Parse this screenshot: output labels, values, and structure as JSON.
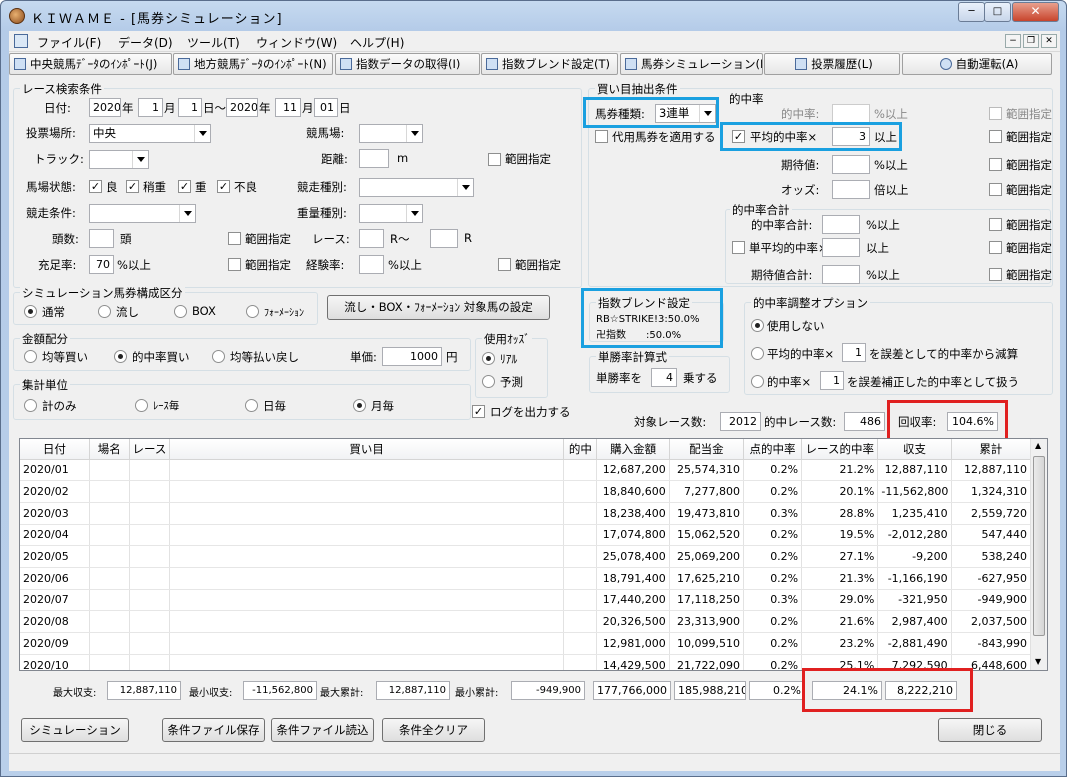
{
  "window": {
    "title": "ＫＩＷＡＭＥ - [馬券シミュレーション]",
    "min": "─",
    "max": "□",
    "close": "✕"
  },
  "menu": [
    "ファイル(F)",
    "データ(D)",
    "ツール(T)",
    "ウィンドウ(W)",
    "ヘルプ(H)"
  ],
  "mdi": {
    "min": "−",
    "restore": "❐",
    "close": "✕"
  },
  "toolbar": [
    "中央競馬ﾃﾞｰﾀのｲﾝﾎﾟｰﾄ(J)",
    "地方競馬ﾃﾞｰﾀのｲﾝﾎﾟｰﾄ(N)",
    "指数データの取得(I)",
    "指数ブレンド設定(T)",
    "馬券シミュレーション(B)",
    "投票履歴(L)",
    "自動運転(A)"
  ],
  "race": {
    "title": "レース検索条件",
    "date_label": "日付:",
    "y1": "2020",
    "y_unit": "年",
    "m1": "1",
    "m_unit": "月",
    "d1": "1",
    "d_unit_tilde": "日～",
    "y2": "2020",
    "m2": "11",
    "d2": "01",
    "d_unit": "日",
    "venue_type_label": "投票場所:",
    "venue_type": "中央",
    "course_label": "競馬場:",
    "course": "",
    "track_label": "トラック:",
    "track": "",
    "distance_label": "距離:",
    "distance": "",
    "distance_unit": "m",
    "range": "範囲指定",
    "baba_label": "馬場状態:",
    "baba": [
      "良",
      "稍重",
      "重",
      "不良"
    ],
    "kind_label": "競走種別:",
    "kind": "",
    "cond_label": "競走条件:",
    "cond": "",
    "weight_label": "重量種別:",
    "weight": "",
    "heads_label": "頭数:",
    "heads": "",
    "heads_unit": "頭",
    "racenum_label": "レース:",
    "r_from": "",
    "r_tilde": "R～",
    "r_to": "",
    "r_unit": "R",
    "fill_label": "充足率:",
    "fill": "70",
    "fill_unit": "%以上",
    "exp_label": "経験率:",
    "exp": "",
    "exp_unit": "%以上"
  },
  "sim": {
    "title": "シミュレーション馬券構成区分",
    "opts": [
      "通常",
      "流し",
      "BOX",
      "ﾌｫｰﾒｰｼｮﾝ"
    ],
    "btn": "流し・BOX・ﾌｫｰﾒｰｼｮﾝ 対象馬の設定"
  },
  "money": {
    "title": "金額配分",
    "opts": [
      "均等買い",
      "的中率買い",
      "均等払い戻し"
    ],
    "price_label": "単価:",
    "price": "1000",
    "price_unit": "円"
  },
  "odds": {
    "title": "使用ｵｯｽﾞ",
    "opts": [
      "ﾘｱﾙ",
      "予測"
    ]
  },
  "agg": {
    "title": "集計単位",
    "opts": [
      "計のみ",
      "ﾚｰｽ毎",
      "日毎",
      "月毎"
    ]
  },
  "log": "ログを出力する",
  "buy": {
    "title": "買い目抽出条件",
    "type_label": "馬券種類:",
    "type": "3連単",
    "proxy": "代用馬券を適用する"
  },
  "hit": {
    "title": "的中率",
    "rate_label": "的中率:",
    "rate": "",
    "pct_over": "%以上",
    "range": "範囲指定",
    "avg_label": "平均的中率×",
    "avg": "3",
    "over": "以上",
    "exp_label": "期待値:",
    "exp": "",
    "odds_label": "オッズ:",
    "odds": "",
    "odds_unit": "倍以上"
  },
  "hitsum": {
    "title": "的中率合計",
    "sum_label": "的中率合計:",
    "sum": "",
    "single_label": "単平均的中率×",
    "single": "",
    "expsum_label": "期待値合計:",
    "expsum": ""
  },
  "blend": {
    "title": "指数ブレンド設定",
    "l1": "RB☆STRIKE!3:50.0%",
    "l2": "卍指数　　:50.0%"
  },
  "single": {
    "title": "単勝率計算式",
    "pre": "単勝率を",
    "val": "4",
    "post": "乗する"
  },
  "adjust": {
    "title": "的中率調整オプション",
    "none": "使用しない",
    "a_pre": "平均的中率×",
    "a_val": "1",
    "a_post": "を誤差として的中率から減算",
    "b_pre": "的中率×",
    "b_val": "1",
    "b_post": "を誤差補正した的中率として扱う"
  },
  "stats": {
    "races_label": "対象レース数:",
    "races": "2012",
    "hits_label": "的中レース数:",
    "hits": "486",
    "recov_label": "回収率:",
    "recov": "104.6%"
  },
  "table": {
    "headers": [
      "日付",
      "場名",
      "レース",
      "買い目",
      "的中",
      "購入金額",
      "配当金",
      "点的中率",
      "レース的中率",
      "収支",
      "累計"
    ],
    "rows": [
      [
        "2020/01",
        "",
        "",
        "",
        "",
        "12,687,200",
        "25,574,310",
        "0.2%",
        "21.2%",
        "12,887,110",
        "12,887,110"
      ],
      [
        "2020/02",
        "",
        "",
        "",
        "",
        "18,840,600",
        "7,277,800",
        "0.2%",
        "20.1%",
        "-11,562,800",
        "1,324,310"
      ],
      [
        "2020/03",
        "",
        "",
        "",
        "",
        "18,238,400",
        "19,473,810",
        "0.3%",
        "28.8%",
        "1,235,410",
        "2,559,720"
      ],
      [
        "2020/04",
        "",
        "",
        "",
        "",
        "17,074,800",
        "15,062,520",
        "0.2%",
        "19.5%",
        "-2,012,280",
        "547,440"
      ],
      [
        "2020/05",
        "",
        "",
        "",
        "",
        "25,078,400",
        "25,069,200",
        "0.2%",
        "27.1%",
        "-9,200",
        "538,240"
      ],
      [
        "2020/06",
        "",
        "",
        "",
        "",
        "18,791,400",
        "17,625,210",
        "0.2%",
        "21.3%",
        "-1,166,190",
        "-627,950"
      ],
      [
        "2020/07",
        "",
        "",
        "",
        "",
        "17,440,200",
        "17,118,250",
        "0.3%",
        "29.0%",
        "-321,950",
        "-949,900"
      ],
      [
        "2020/08",
        "",
        "",
        "",
        "",
        "20,326,500",
        "23,313,900",
        "0.2%",
        "21.6%",
        "2,987,400",
        "2,037,500"
      ],
      [
        "2020/09",
        "",
        "",
        "",
        "",
        "12,981,000",
        "10,099,510",
        "0.2%",
        "23.2%",
        "-2,881,490",
        "-843,990"
      ],
      [
        "2020/10",
        "",
        "",
        "",
        "",
        "14,429,500",
        "21,722,090",
        "0.2%",
        "25.1%",
        "7,292,590",
        "6,448,600"
      ]
    ]
  },
  "summary": {
    "max_inc_label": "最大収支:",
    "max_inc": "12,887,110",
    "min_inc_label": "最小収支:",
    "min_inc": "-11,562,800",
    "max_cum_label": "最大累計:",
    "max_cum": "12,887,110",
    "min_cum_label": "最小累計:",
    "min_cum": "-949,900",
    "buy": "177,766,000",
    "pay": "185,988,210",
    "pt": "0.2%",
    "race": "24.1%",
    "inc": "8,222,210"
  },
  "buttons": {
    "sim": "シミュレーション",
    "save": "条件ファイル保存",
    "load": "条件ファイル読込",
    "clear": "条件全クリア",
    "close": "閉じる"
  }
}
